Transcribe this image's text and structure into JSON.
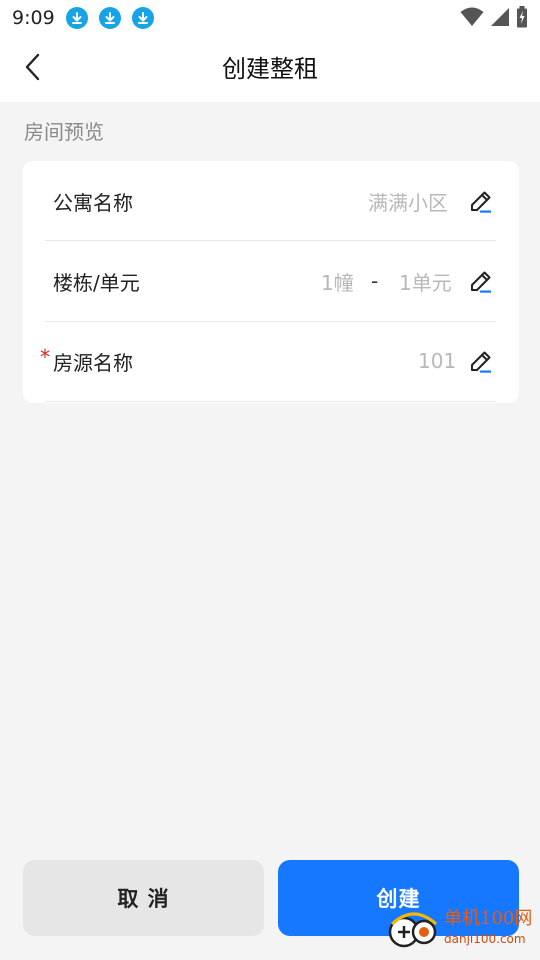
{
  "status_bar": {
    "time": "9:09",
    "notification_icons": [
      "download-icon",
      "download-icon",
      "download-icon"
    ],
    "right_icons": [
      "wifi-icon",
      "signal-icon",
      "battery-charging-icon"
    ]
  },
  "header": {
    "title": "创建整租",
    "back_icon": "chevron-left-icon"
  },
  "section": {
    "title": "房间预览"
  },
  "form": {
    "rows": [
      {
        "label": "公寓名称",
        "value": "满满小区",
        "required": false,
        "icon": "edit-pen-icon"
      },
      {
        "label": "楼栋/单元",
        "building": "1幢",
        "separator": "-",
        "unit": "1单元",
        "required": false,
        "icon": "edit-pen-icon"
      },
      {
        "label": "房源名称",
        "value": "101",
        "required": true,
        "required_mark": "*",
        "icon": "edit-pen-icon"
      }
    ]
  },
  "footer": {
    "cancel_label": "取 消",
    "create_label": "创建"
  },
  "watermark": {
    "name": "单机100网",
    "url": "danji100.com"
  },
  "colors": {
    "primary": "#1677ff",
    "background": "#f4f4f4",
    "required": "#e02020",
    "placeholder": "#b8b8b8",
    "download_badge": "#16a3e8"
  }
}
